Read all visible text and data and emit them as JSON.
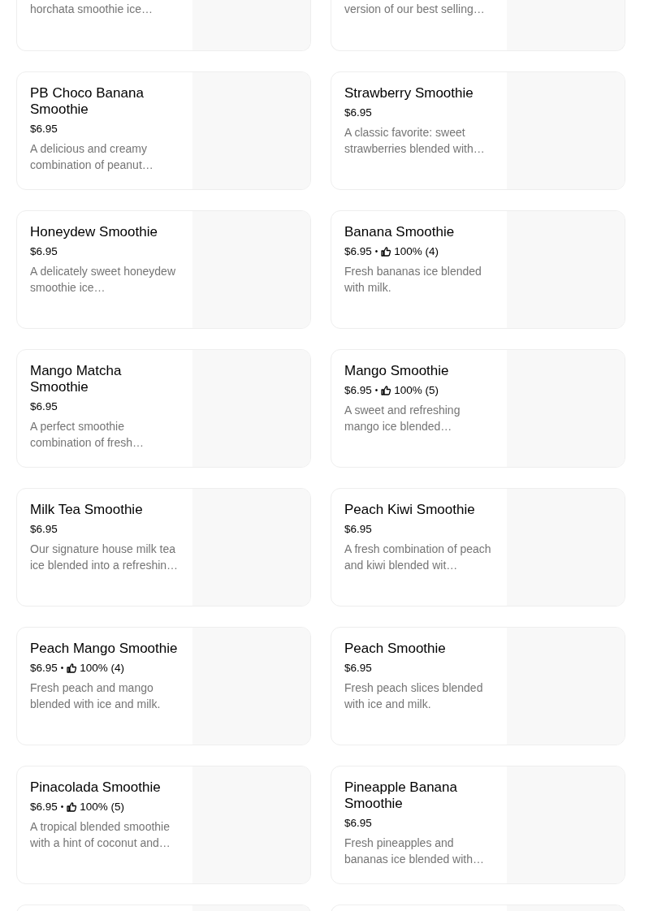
{
  "partial_top": [
    {
      "description": "horchata smoothie ice…"
    },
    {
      "description": "version of our best selling…"
    }
  ],
  "items": [
    {
      "name": "PB Choco Banana Smoothie",
      "price": "$6.95",
      "description": "A delicious and creamy combination of peanut…"
    },
    {
      "name": "Strawberry Smoothie",
      "price": "$6.95",
      "description": "A classic favorite: sweet strawberries blended with…"
    },
    {
      "name": "Honeydew Smoothie",
      "price": "$6.95",
      "description": "A delicately sweet honeydew smoothie ice…"
    },
    {
      "name": "Banana Smoothie",
      "price": "$6.95",
      "separator": "•",
      "rating": "100% (4)",
      "description": "Fresh bananas ice blended with milk."
    },
    {
      "name": "Mango Matcha Smoothie",
      "price": "$6.95",
      "description": "A perfect smoothie combination of fresh…"
    },
    {
      "name": "Mango Smoothie",
      "price": "$6.95",
      "separator": "•",
      "rating": "100% (5)",
      "description": "A sweet and refreshing mango ice blended…"
    },
    {
      "name": "Milk Tea Smoothie",
      "price": "$6.95",
      "description": "Our signature house milk tea ice blended into a refreshin…"
    },
    {
      "name": "Peach Kiwi Smoothie",
      "price": "$6.95",
      "description": "A fresh combination of peach and kiwi blended wit…"
    },
    {
      "name": "Peach Mango Smoothie",
      "price": "$6.95",
      "separator": "•",
      "rating": "100% (4)",
      "description": "Fresh peach and mango blended with ice and milk."
    },
    {
      "name": "Peach Smoothie",
      "price": "$6.95",
      "description": "Fresh peach slices blended with ice and milk."
    },
    {
      "name": "Pinacolada Smoothie",
      "price": "$6.95",
      "separator": "•",
      "rating": "100% (5)",
      "description": "A tropical blended smoothie with a hint of coconut and…"
    },
    {
      "name": "Pineapple Banana Smoothie",
      "price": "$6.95",
      "description": "Fresh pineapples and bananas ice blended with…"
    }
  ],
  "partial_bottom": [
    {
      "kind": "card"
    },
    {
      "kind": "card"
    }
  ]
}
